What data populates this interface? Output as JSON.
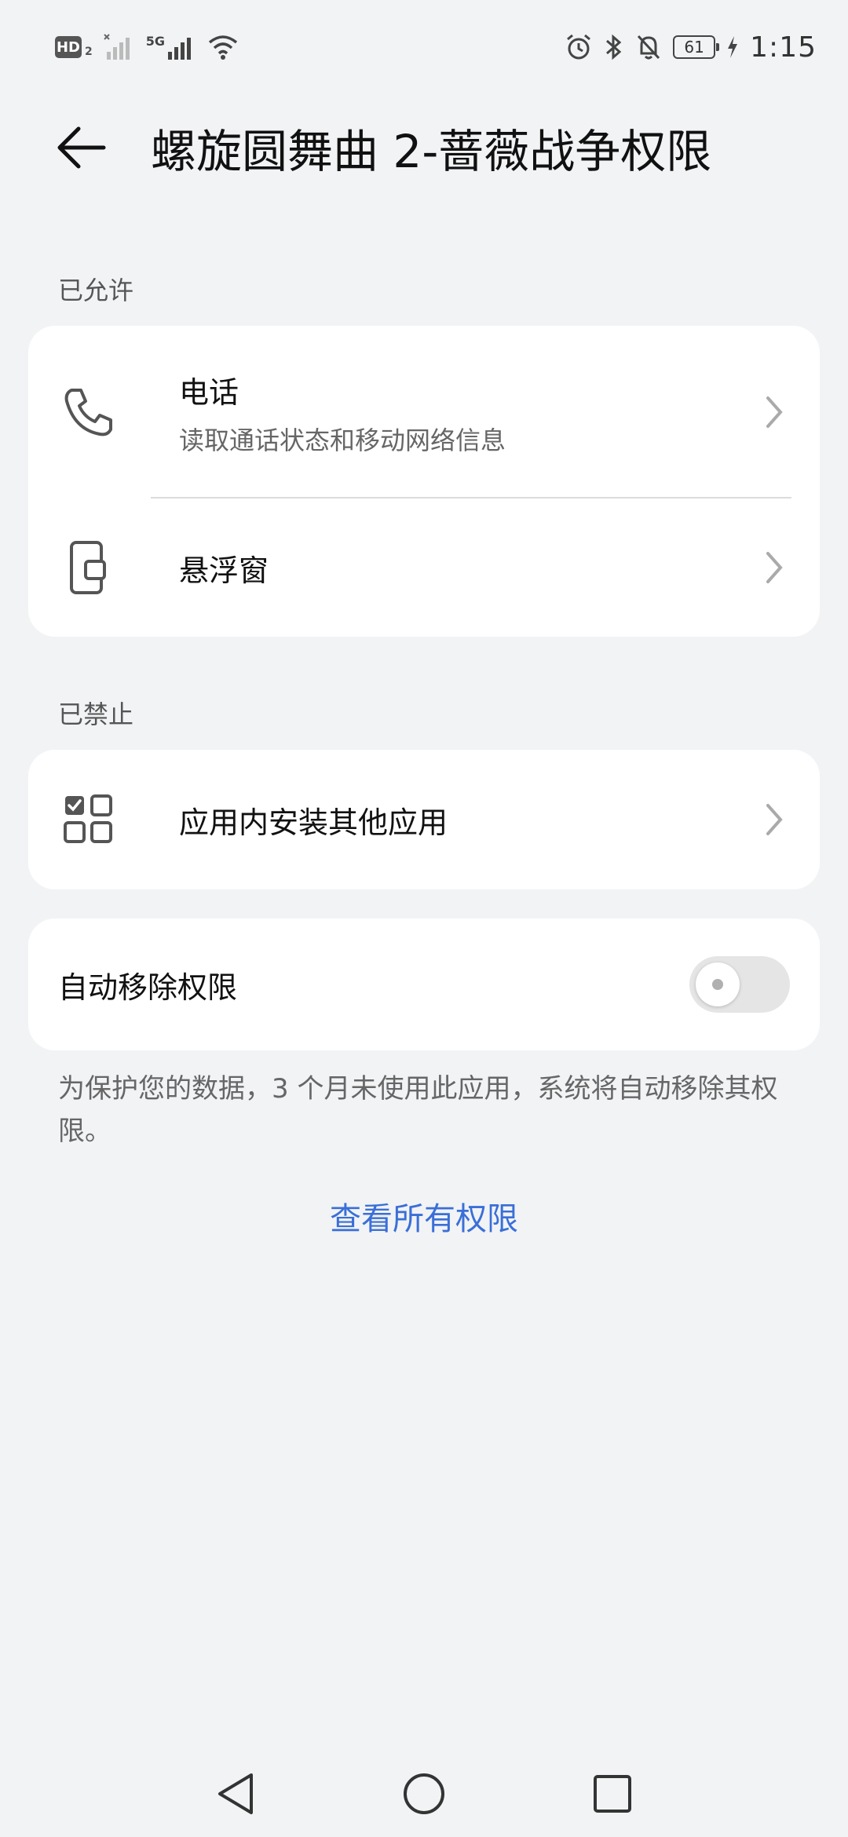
{
  "status_bar": {
    "hd_label": "HD",
    "hd_sub": "2",
    "network_label": "5G",
    "battery": "61",
    "time": "1:15"
  },
  "header": {
    "title": "螺旋圆舞曲 2-蔷薇战争权限"
  },
  "allowed": {
    "label": "已允许",
    "items": [
      {
        "title": "电话",
        "subtitle": "读取通话状态和移动网络信息",
        "icon": "phone-icon"
      },
      {
        "title": "悬浮窗",
        "icon": "floating-window-icon"
      }
    ]
  },
  "denied": {
    "label": "已禁止",
    "items": [
      {
        "title": "应用内安装其他应用",
        "icon": "app-install-icon"
      }
    ]
  },
  "auto_remove": {
    "label": "自动移除权限",
    "enabled": false,
    "note": "为保护您的数据，3 个月未使用此应用，系统将自动移除其权限。"
  },
  "view_all_link": "查看所有权限",
  "colors": {
    "background": "#f1f3f5",
    "card": "#ffffff",
    "accent": "#3a6fd8"
  }
}
